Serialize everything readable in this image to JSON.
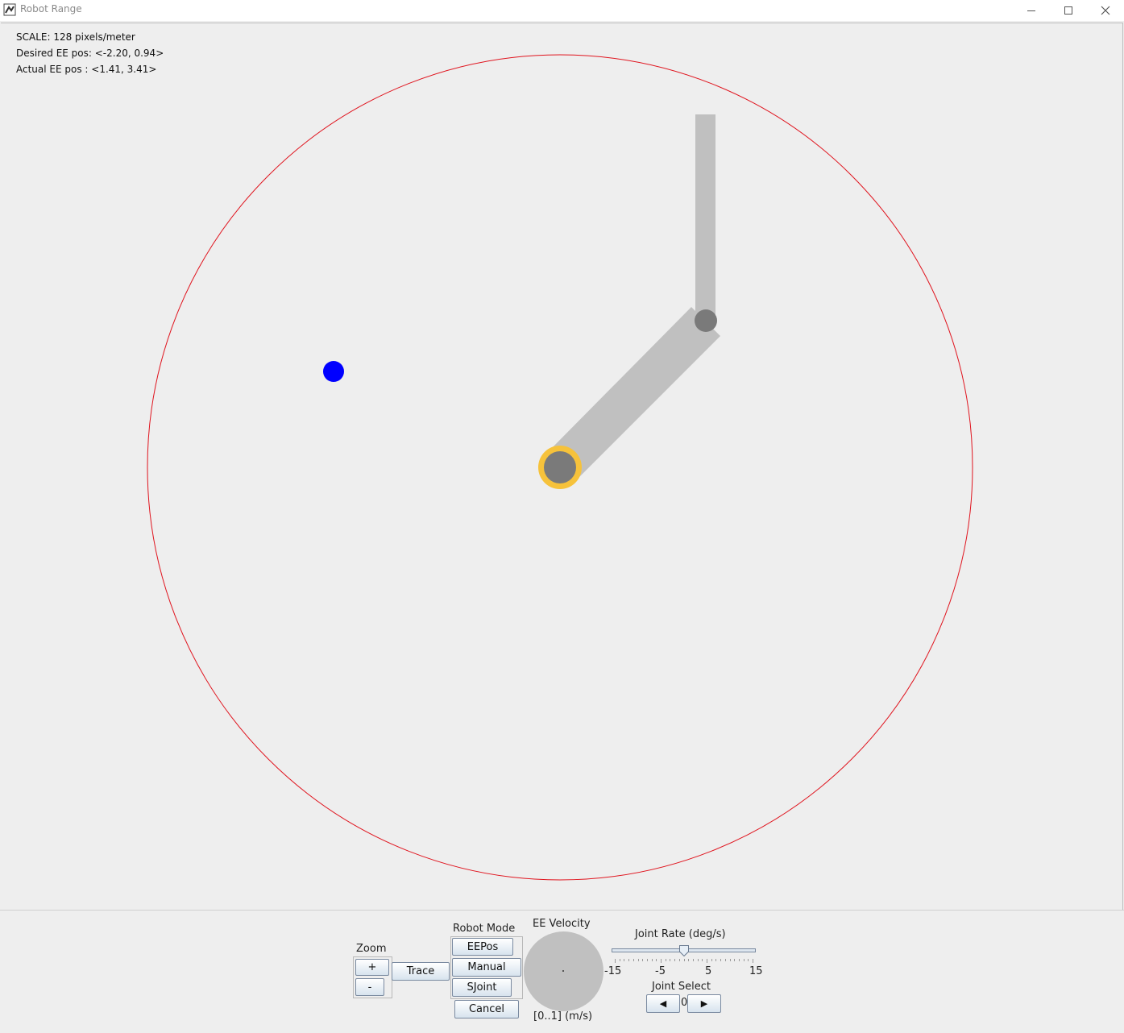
{
  "window": {
    "title": "Robot Range",
    "icon": "robot-app-icon",
    "controls": [
      "minimize-icon",
      "maximize-icon",
      "close-icon"
    ]
  },
  "canvas": {
    "scale_text": "SCALE: 128 pixels/meter",
    "desired_text": "Desired EE pos: <-2.20, 0.94>",
    "actual_text": "Actual EE pos : <1.41, 3.41>",
    "colors": {
      "range_circle": "#e0141e",
      "arm_link": "#c0c0c0",
      "joint": "#7a7a7a",
      "base_ring": "#f6c23b",
      "target": "#0000ff"
    }
  },
  "controls": {
    "zoom": {
      "label": "Zoom",
      "plus": "+",
      "minus": "-"
    },
    "trace": "Trace",
    "robot_mode": {
      "label": "Robot Mode",
      "eepos": "EEPos",
      "manual": "Manual",
      "sjoint": "SJoint",
      "cancel": "Cancel"
    },
    "ee_velocity": {
      "label": "EE Velocity",
      "range": "[0..1] (m/s)"
    },
    "joint_rate": {
      "label": "Joint Rate (deg/s)",
      "min": -15,
      "max": 15,
      "value": 0,
      "ticks": [
        "-15",
        "-5",
        "5",
        "15"
      ]
    },
    "joint_select": {
      "label": "Joint Select",
      "value": "0",
      "prev_icon": "left-arrow-icon",
      "next_icon": "right-arrow-icon"
    }
  }
}
